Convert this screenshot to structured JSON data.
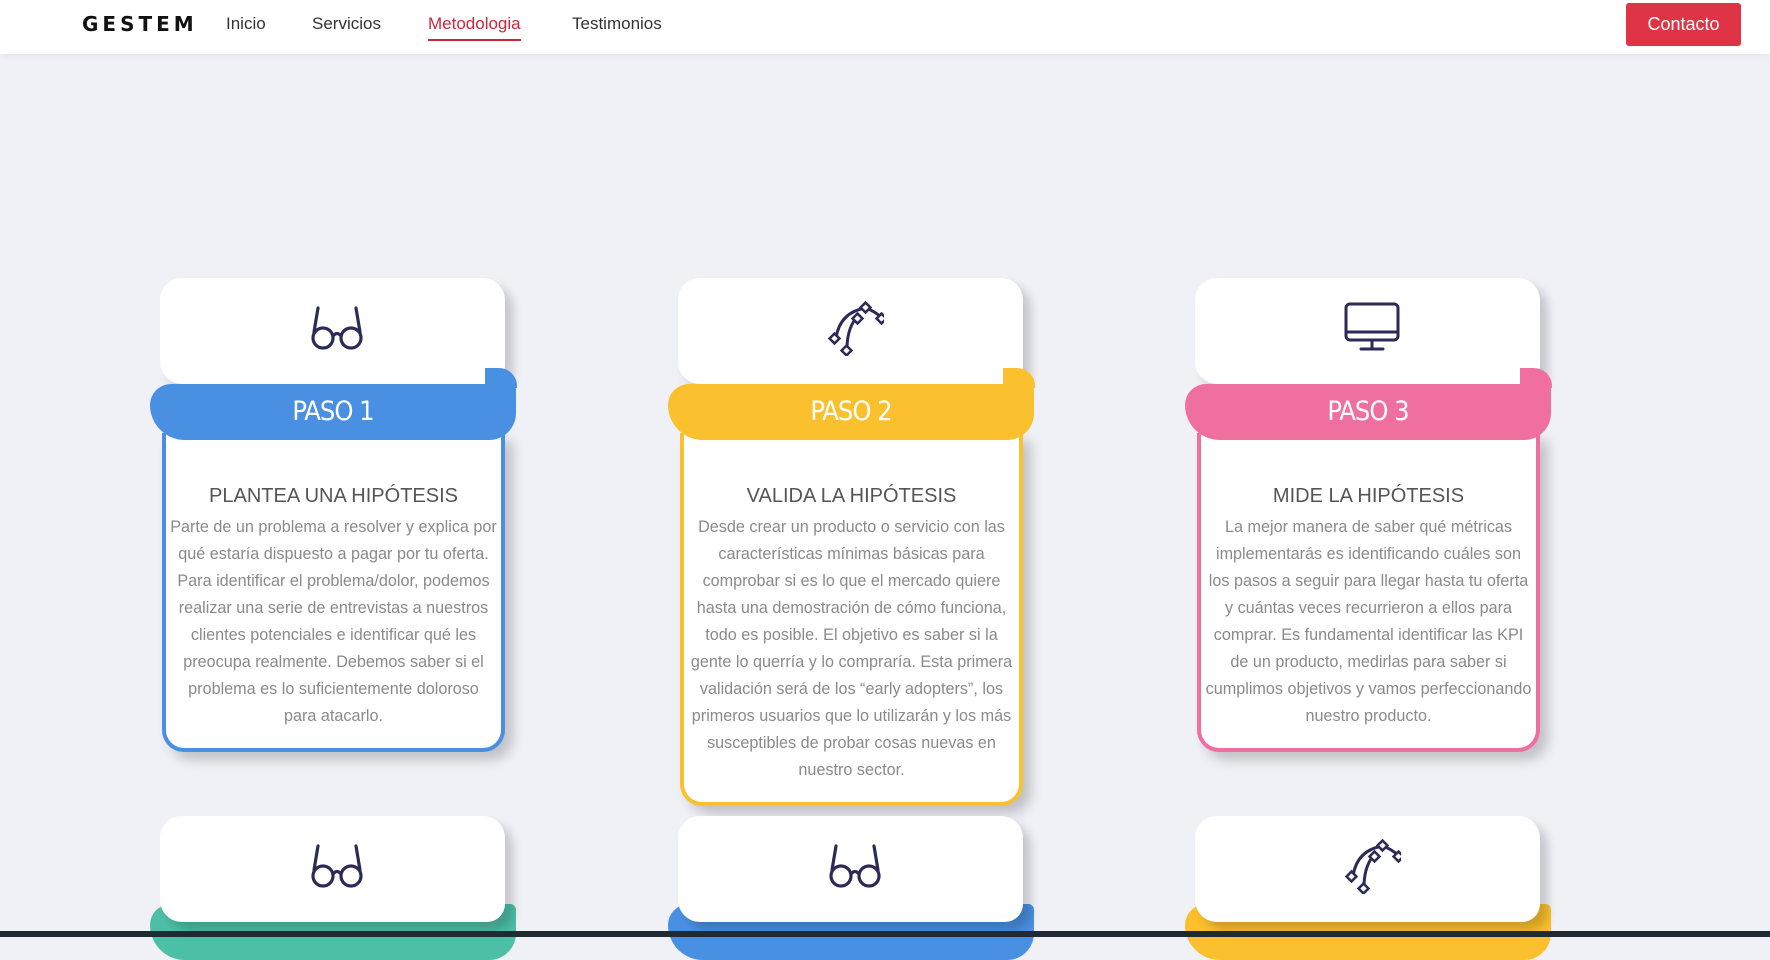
{
  "nav": {
    "brand": "GESTEM",
    "links": [
      "Inicio",
      "Servicios",
      "Metodologia",
      "Testimonios"
    ],
    "active_link": "Metodologia",
    "contact_label": "Contacto"
  },
  "colors": {
    "accent_red": "#df3346",
    "blue": "#4a90e2",
    "yellow": "#fbc02d",
    "pink": "#f06fa1",
    "teal": "#4dbfa6",
    "icon": "#2c2a57"
  },
  "steps": [
    {
      "icon": "glasses-icon",
      "color": "#4a90e2",
      "label": "PASO 1",
      "title": "PLANTEA UNA HIPÓTESIS",
      "desc": "Parte de un problema a resolver y explica por qué estaría dispuesto a pagar por tu oferta. Para identificar el problema/dolor, podemos realizar una serie de entrevistas a nuestros clientes potenciales e identificar qué les preocupa realmente. Debemos saber si el problema es lo suficientemente doloroso para atacarlo."
    },
    {
      "icon": "bezier-curve-icon",
      "color": "#fbc02d",
      "label": "PASO 2",
      "title": "VALIDA LA HIPÓTESIS",
      "desc": "Desde crear un producto o servicio con las características mínimas básicas para comprobar si es lo que el mercado quiere hasta una demostración de cómo funciona, todo es posible. El objetivo es saber si la gente lo querría y lo compraría. Esta primera validación será de los “early adopters”, los primeros usuarios que lo utilizarán y los más susceptibles de probar cosas nuevas en nuestro sector."
    },
    {
      "icon": "monitor-icon",
      "color": "#f06fa1",
      "label": "PASO 3",
      "title": "MIDE LA HIPÓTESIS",
      "desc": "La mejor manera de saber qué métricas implementarás es identificando cuáles son los pasos a seguir para llegar hasta tu oferta y cuántas veces recurrieron a ellos para comprar. Es fundamental identificar las KPI de un producto, medirlas para saber si cumplimos objetivos y vamos perfeccionando nuestro producto."
    }
  ],
  "partial_steps": [
    {
      "icon": "glasses-icon",
      "color": "#4dbfa6"
    },
    {
      "icon": "glasses-icon",
      "color": "#4a90e2"
    },
    {
      "icon": "bezier-curve-icon",
      "color": "#fbc02d"
    }
  ]
}
